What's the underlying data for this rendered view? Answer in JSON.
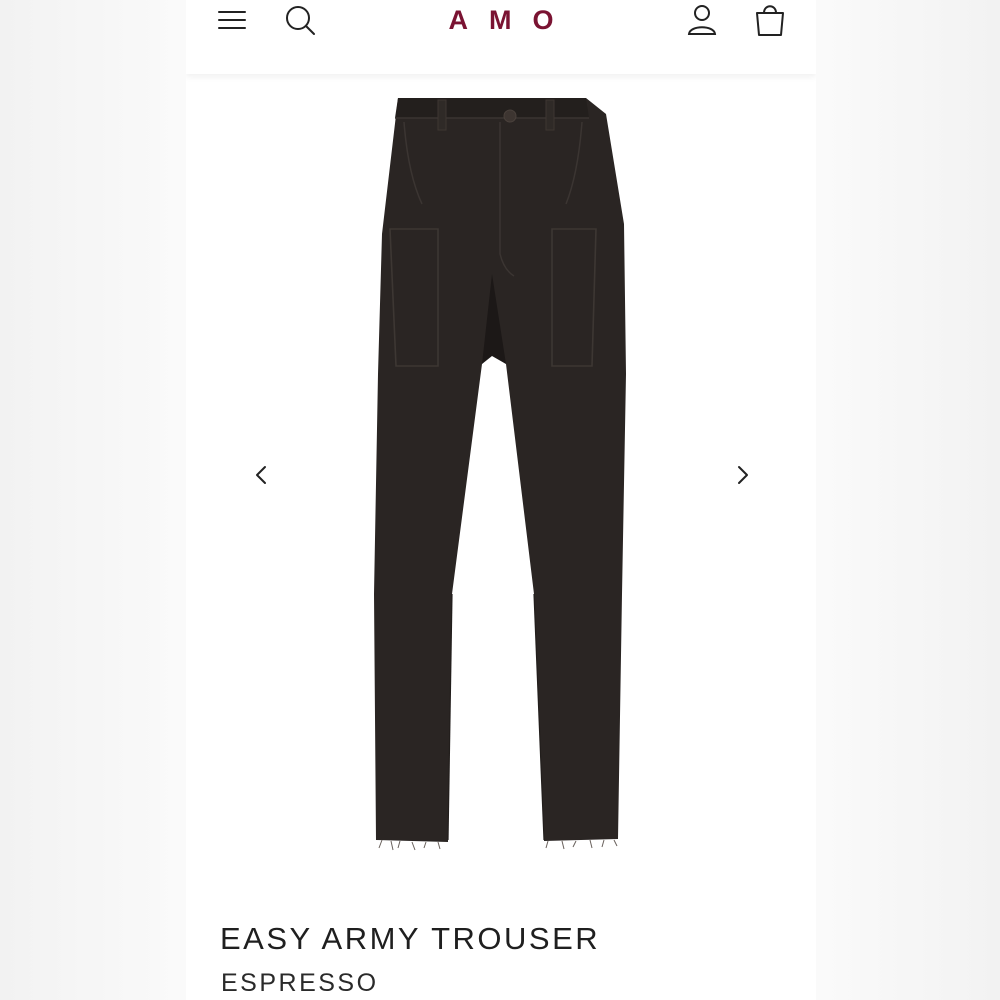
{
  "header": {
    "brand": "AMO",
    "brand_color": "#7a1332",
    "icons": [
      "menu-icon",
      "search-icon",
      "account-icon",
      "bag-icon"
    ]
  },
  "gallery": {
    "image_subject": "black straight-leg utility trousers with front patch pockets and raw hems",
    "prev_icon": "chevron-left-icon",
    "next_icon": "chevron-right-icon"
  },
  "product": {
    "name": "EASY ARMY TROUSER",
    "color": "ESPRESSO"
  }
}
